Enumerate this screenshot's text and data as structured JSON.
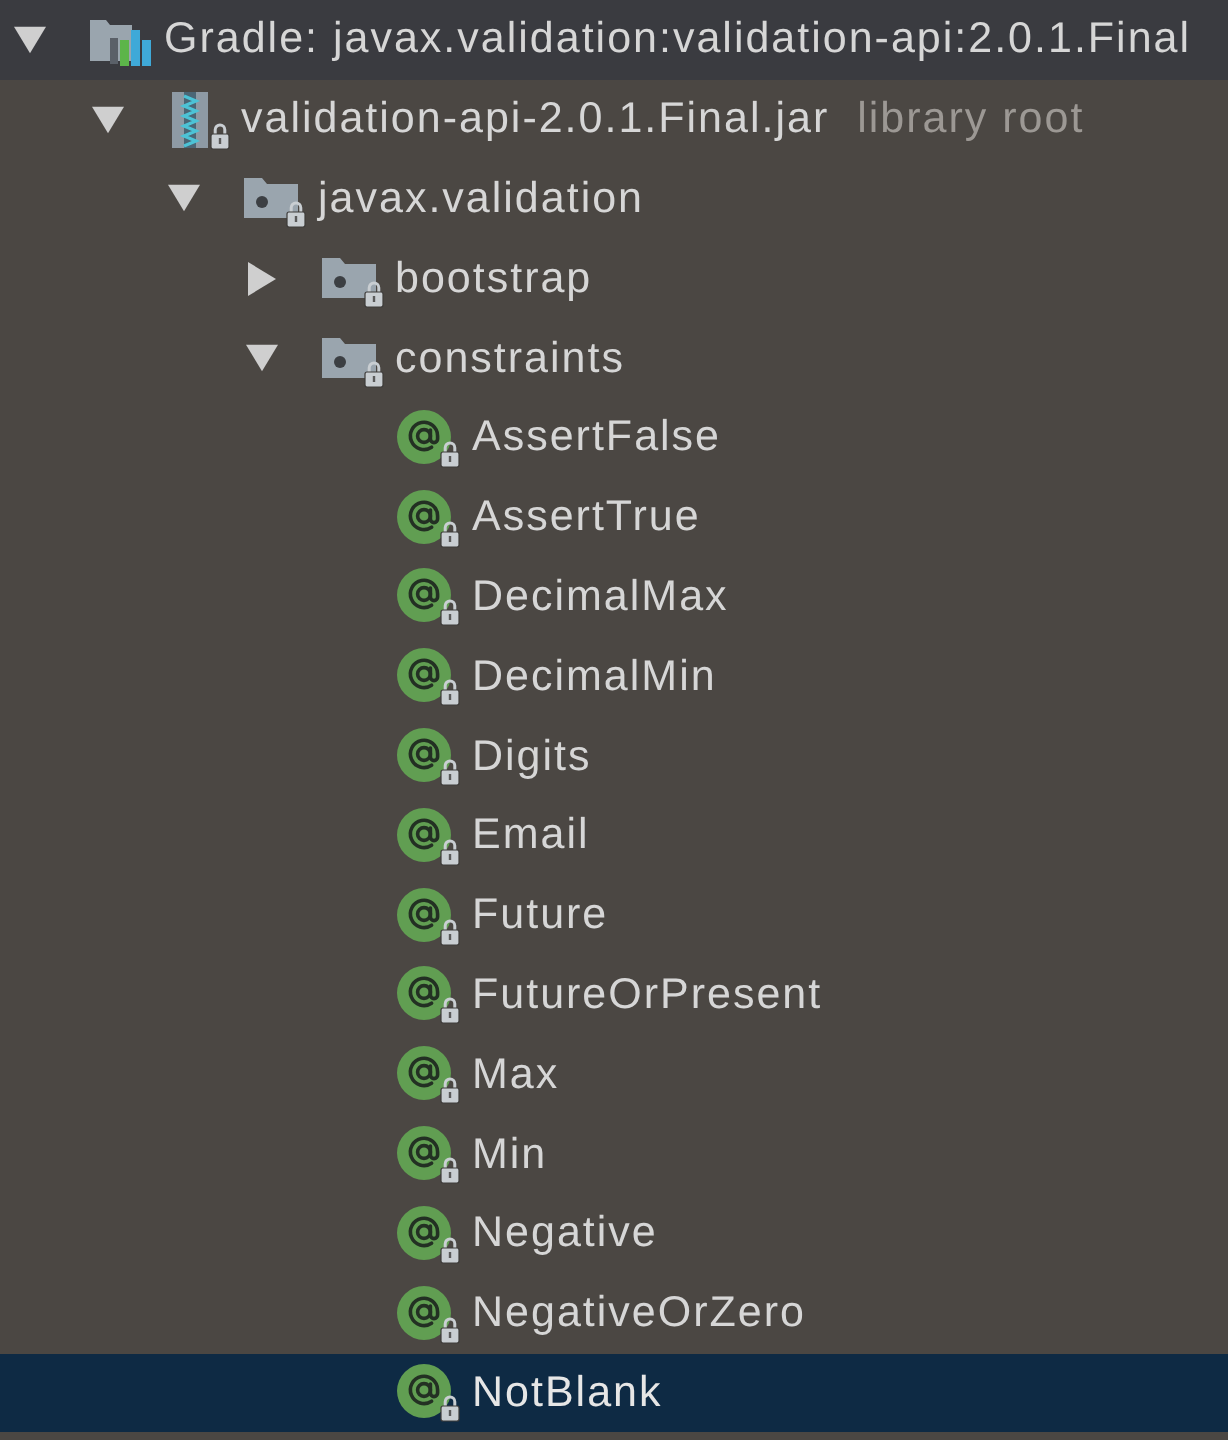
{
  "tree": {
    "nodes": [
      {
        "kind": "gradle-library",
        "label": "Gradle: javax.validation:validation-api:2.0.1.Final",
        "expanded": true,
        "selected": false,
        "hovered": true,
        "children": [
          {
            "kind": "jar",
            "label": "validation-api-2.0.1.Final.jar",
            "note": "library root",
            "expanded": true,
            "selected": false,
            "hovered": false,
            "children": [
              {
                "kind": "package",
                "label": "javax.validation",
                "expanded": true,
                "selected": false,
                "hovered": false,
                "children": [
                  {
                    "kind": "package",
                    "label": "bootstrap",
                    "expanded": false,
                    "selected": false,
                    "hovered": false
                  },
                  {
                    "kind": "package",
                    "label": "constraints",
                    "expanded": true,
                    "selected": false,
                    "hovered": false,
                    "children": [
                      {
                        "kind": "annotation",
                        "label": "AssertFalse",
                        "selected": false,
                        "hovered": false
                      },
                      {
                        "kind": "annotation",
                        "label": "AssertTrue",
                        "selected": false,
                        "hovered": false
                      },
                      {
                        "kind": "annotation",
                        "label": "DecimalMax",
                        "selected": false,
                        "hovered": false
                      },
                      {
                        "kind": "annotation",
                        "label": "DecimalMin",
                        "selected": false,
                        "hovered": false
                      },
                      {
                        "kind": "annotation",
                        "label": "Digits",
                        "selected": false,
                        "hovered": false
                      },
                      {
                        "kind": "annotation",
                        "label": "Email",
                        "selected": false,
                        "hovered": false
                      },
                      {
                        "kind": "annotation",
                        "label": "Future",
                        "selected": false,
                        "hovered": false
                      },
                      {
                        "kind": "annotation",
                        "label": "FutureOrPresent",
                        "selected": false,
                        "hovered": false
                      },
                      {
                        "kind": "annotation",
                        "label": "Max",
                        "selected": false,
                        "hovered": false
                      },
                      {
                        "kind": "annotation",
                        "label": "Min",
                        "selected": false,
                        "hovered": false
                      },
                      {
                        "kind": "annotation",
                        "label": "Negative",
                        "selected": false,
                        "hovered": false
                      },
                      {
                        "kind": "annotation",
                        "label": "NegativeOrZero",
                        "selected": false,
                        "hovered": false
                      },
                      {
                        "kind": "annotation",
                        "label": "NotBlank",
                        "selected": true,
                        "hovered": false
                      }
                    ]
                  }
                ]
              }
            ]
          }
        ]
      }
    ]
  }
}
